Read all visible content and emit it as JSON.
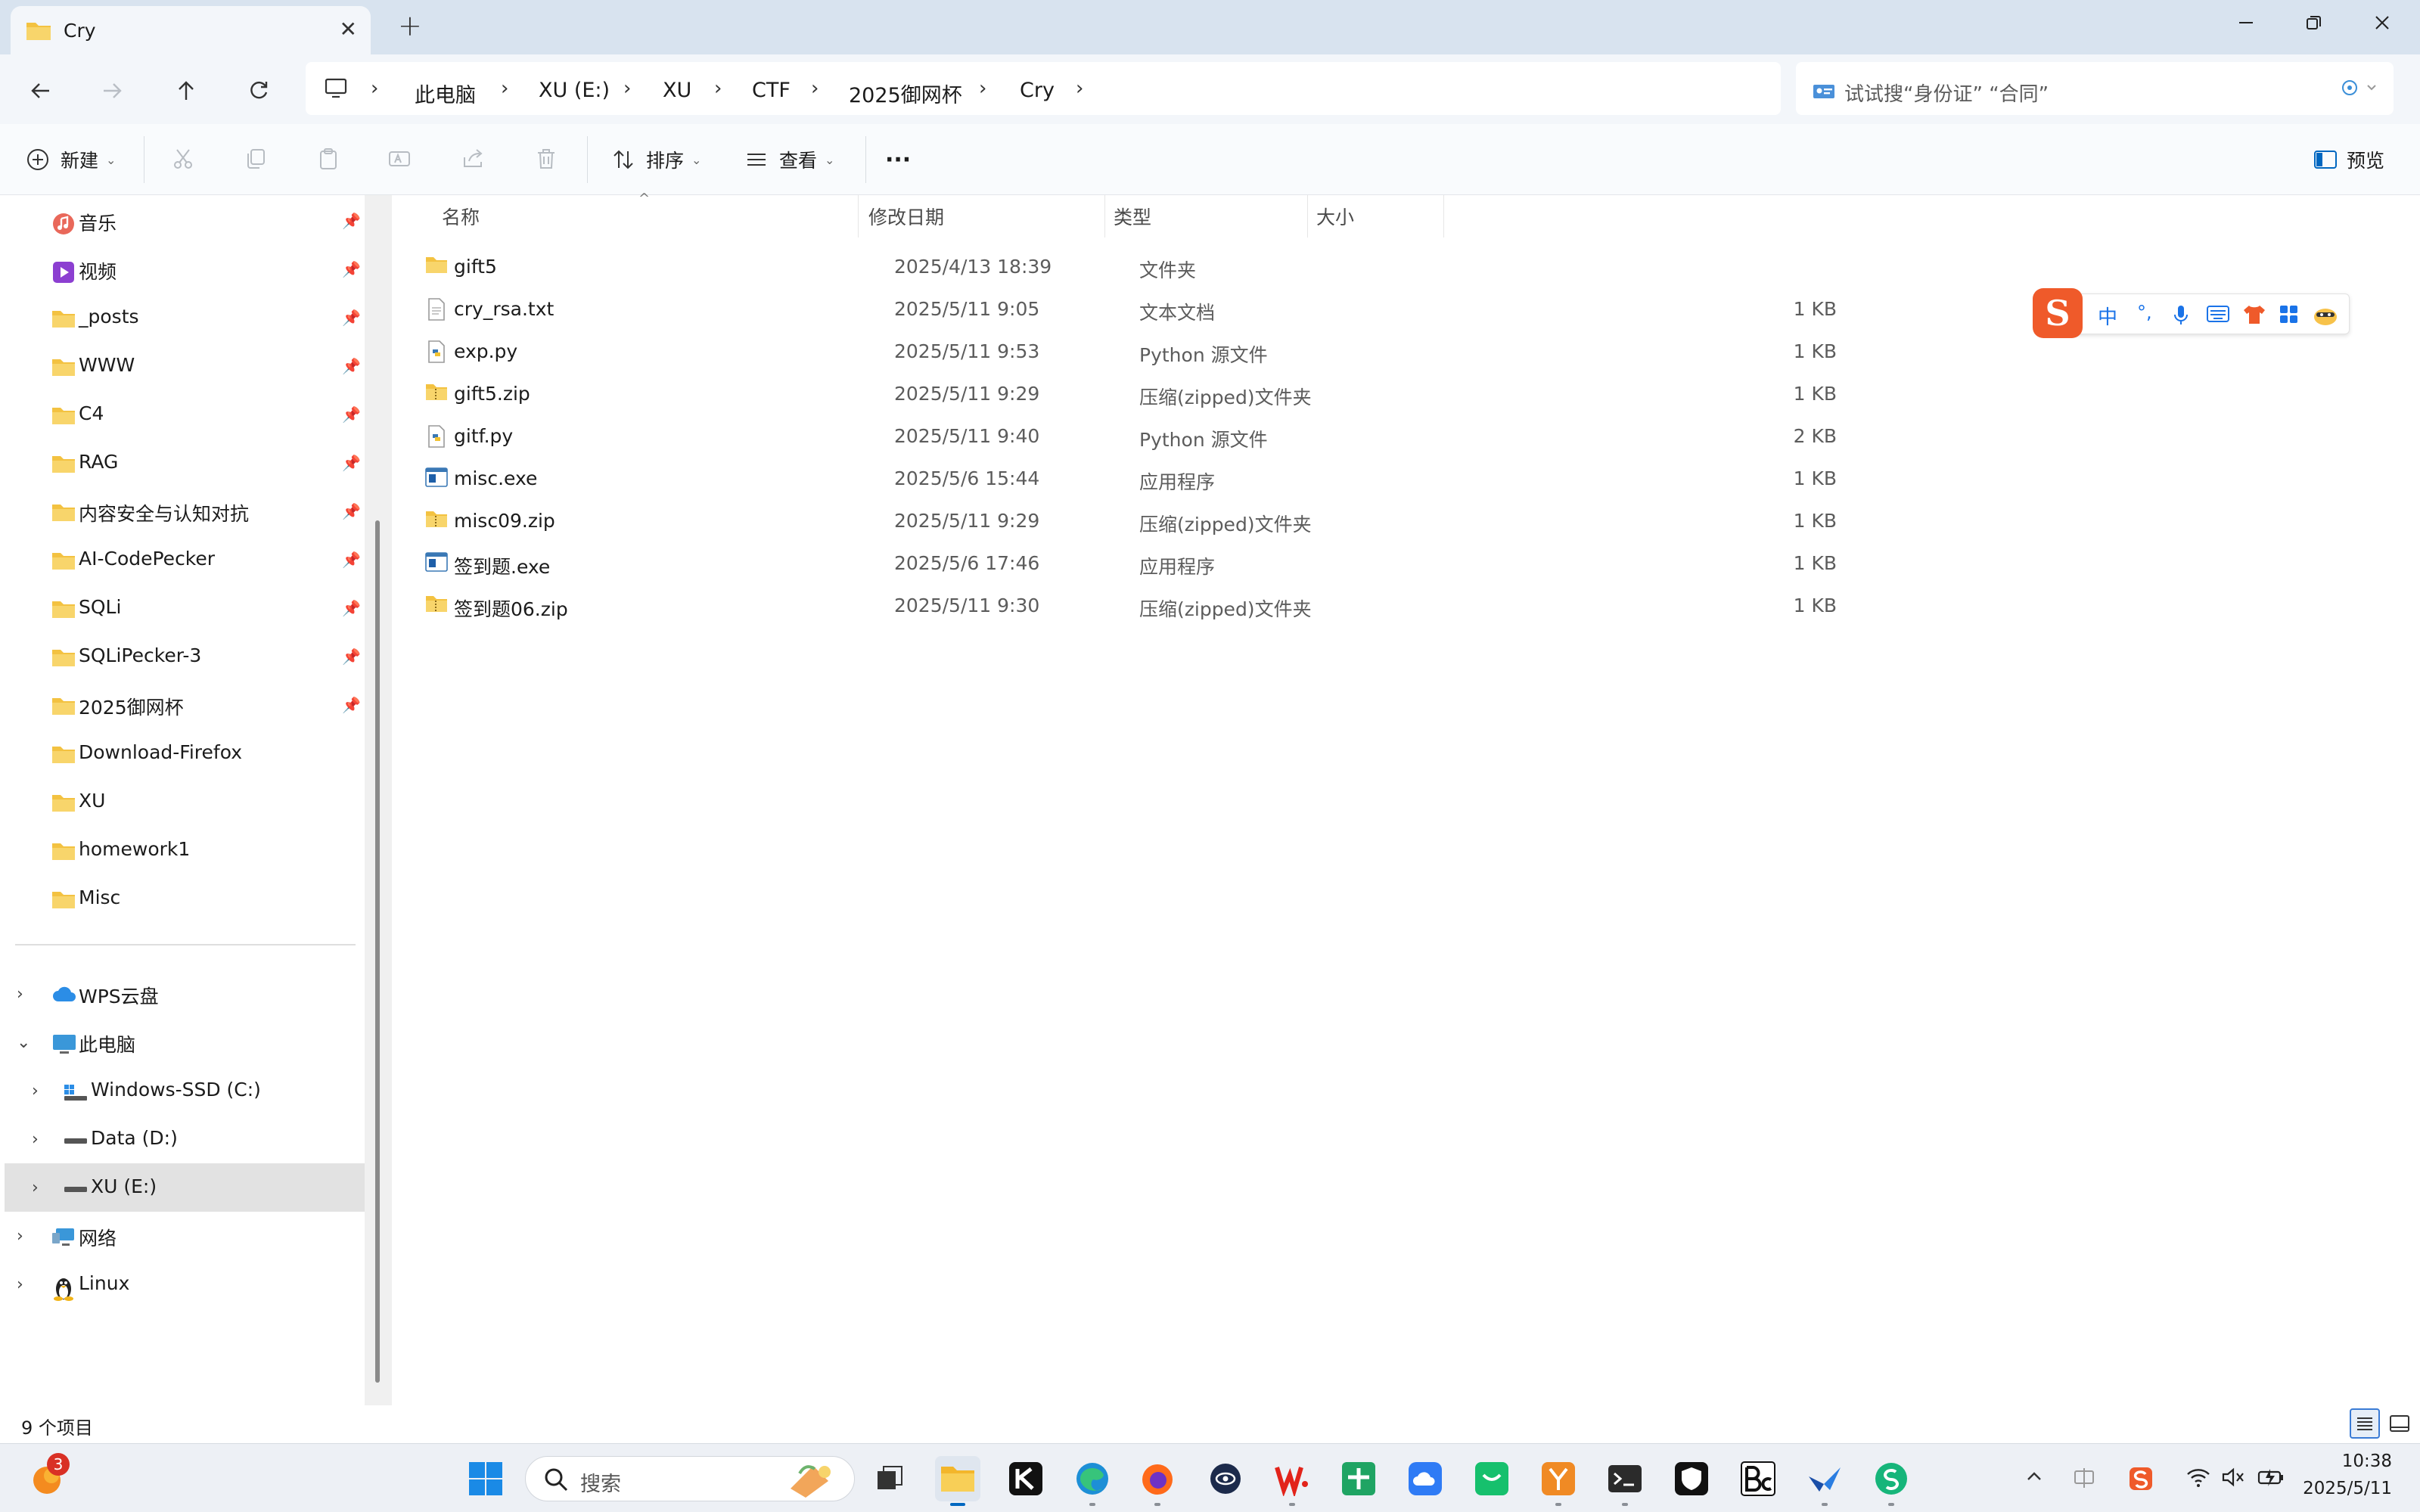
{
  "window": {
    "tab_title": "Cry",
    "new_tab_label": "+",
    "close_tab_label": "✕"
  },
  "breadcrumb": [
    "此电脑",
    "XU (E:)",
    "XU",
    "CTF",
    "2025御网杯",
    "Cry"
  ],
  "search": {
    "placeholder": "试试搜“身份证” “合同”"
  },
  "toolbar": {
    "new_label": "新建",
    "sort_label": "排序",
    "view_label": "查看",
    "more_label": "···",
    "preview_label": "预览"
  },
  "sidebar": {
    "quick_access": [
      {
        "label": "音乐",
        "icon": "music-icon",
        "pinned": true
      },
      {
        "label": "视频",
        "icon": "video-icon",
        "pinned": true
      },
      {
        "label": "_posts",
        "icon": "folder-icon",
        "pinned": true
      },
      {
        "label": "WWW",
        "icon": "folder-icon",
        "pinned": true
      },
      {
        "label": "C4",
        "icon": "folder-icon",
        "pinned": true
      },
      {
        "label": "RAG",
        "icon": "folder-icon",
        "pinned": true
      },
      {
        "label": "内容安全与认知对抗",
        "icon": "folder-icon",
        "pinned": true
      },
      {
        "label": "AI-CodePecker",
        "icon": "folder-icon",
        "pinned": true
      },
      {
        "label": "SQLi",
        "icon": "folder-icon",
        "pinned": true
      },
      {
        "label": "SQLiPecker-3",
        "icon": "folder-icon",
        "pinned": true
      },
      {
        "label": "2025御网杯",
        "icon": "folder-icon",
        "pinned": true
      },
      {
        "label": "Download-Firefox",
        "icon": "folder-icon",
        "pinned": false
      },
      {
        "label": "XU",
        "icon": "folder-icon",
        "pinned": false
      },
      {
        "label": "homework1",
        "icon": "folder-icon",
        "pinned": false
      },
      {
        "label": "Misc",
        "icon": "folder-icon",
        "pinned": false
      }
    ],
    "tree": [
      {
        "label": "WPS云盘",
        "icon": "cloud-icon",
        "expanded": false,
        "level": 0
      },
      {
        "label": "此电脑",
        "icon": "pc-icon",
        "expanded": true,
        "level": 0
      },
      {
        "label": "Windows-SSD (C:)",
        "icon": "windows-drive-icon",
        "expanded": false,
        "level": 1
      },
      {
        "label": "Data (D:)",
        "icon": "drive-icon",
        "expanded": false,
        "level": 1
      },
      {
        "label": "XU (E:)",
        "icon": "drive-icon",
        "expanded": false,
        "level": 1,
        "selected": true
      },
      {
        "label": "网络",
        "icon": "network-icon",
        "expanded": false,
        "level": 0
      },
      {
        "label": "Linux",
        "icon": "linux-icon",
        "expanded": false,
        "level": 0
      }
    ]
  },
  "columns": {
    "name": "名称",
    "date": "修改日期",
    "type": "类型",
    "size": "大小"
  },
  "files": [
    {
      "name": "gift5",
      "date": "2025/4/13 18:39",
      "type": "文件夹",
      "size": "",
      "icon": "folder-icon"
    },
    {
      "name": "cry_rsa.txt",
      "date": "2025/5/11 9:05",
      "type": "文本文档",
      "size": "1 KB",
      "icon": "text-file-icon"
    },
    {
      "name": "exp.py",
      "date": "2025/5/11 9:53",
      "type": "Python 源文件",
      "size": "1 KB",
      "icon": "python-file-icon"
    },
    {
      "name": "gift5.zip",
      "date": "2025/5/11 9:29",
      "type": "压缩(zipped)文件夹",
      "size": "1 KB",
      "icon": "zip-folder-icon"
    },
    {
      "name": "gitf.py",
      "date": "2025/5/11 9:40",
      "type": "Python 源文件",
      "size": "2 KB",
      "icon": "python-file-icon"
    },
    {
      "name": "misc.exe",
      "date": "2025/5/6 15:44",
      "type": "应用程序",
      "size": "1 KB",
      "icon": "exe-file-icon"
    },
    {
      "name": "misc09.zip",
      "date": "2025/5/11 9:29",
      "type": "压缩(zipped)文件夹",
      "size": "1 KB",
      "icon": "zip-folder-icon"
    },
    {
      "name": "签到题.exe",
      "date": "2025/5/6 17:46",
      "type": "应用程序",
      "size": "1 KB",
      "icon": "exe-file-icon"
    },
    {
      "name": "签到题06.zip",
      "date": "2025/5/11 9:30",
      "type": "压缩(zipped)文件夹",
      "size": "1 KB",
      "icon": "zip-folder-icon"
    }
  ],
  "ime": {
    "mode_label": "中",
    "punct_label": "°,"
  },
  "status": {
    "item_count": "9 个项目"
  },
  "taskbar": {
    "search_placeholder": "搜索",
    "notification_count": "3",
    "time": "10:38",
    "date": "2025/5/11"
  },
  "colors": {
    "accent": "#0067c0",
    "folder": "#f3c241",
    "selection": "#e2e2e2",
    "titlebar": "#d8e3ef",
    "ime_brand": "#ef5a2a"
  }
}
